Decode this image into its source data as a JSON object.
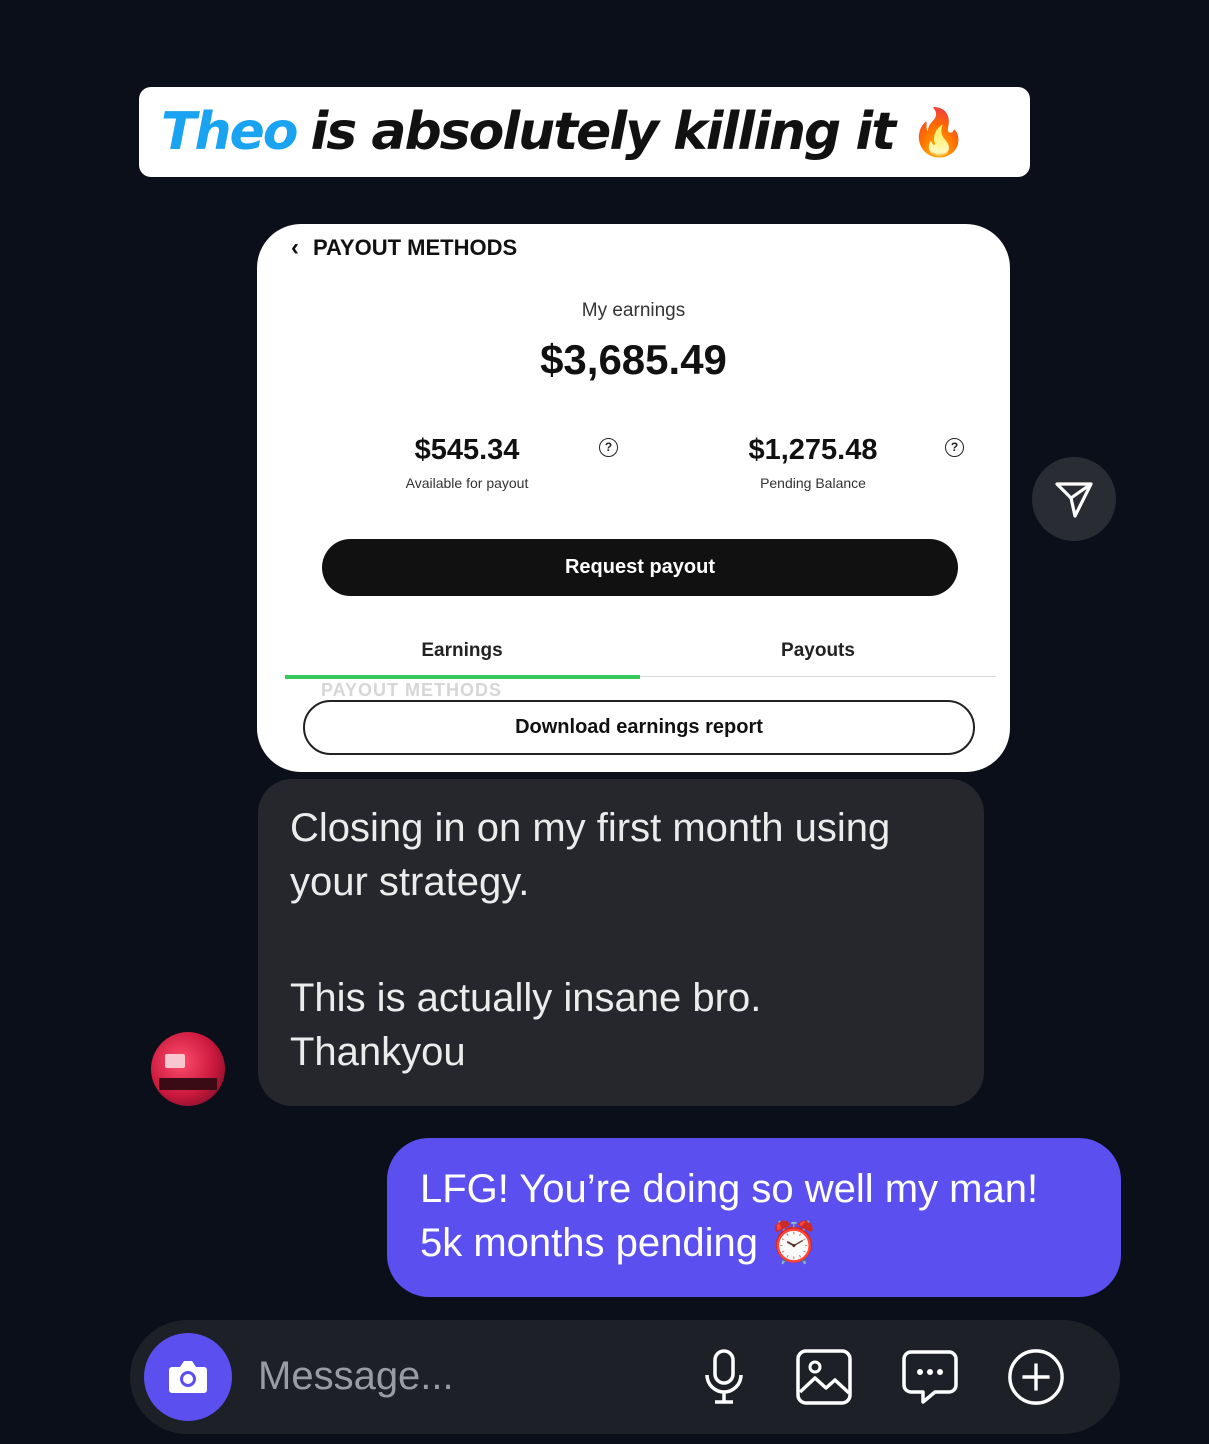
{
  "banner": {
    "name": "Theo",
    "text": "is absolutely killing it",
    "emoji": "🔥"
  },
  "payout_card": {
    "back_label": "PAYOUT METHODS",
    "earnings_label": "My earnings",
    "earnings_total": "$3,685.49",
    "available": {
      "value": "$545.34",
      "label": "Available for payout"
    },
    "pending": {
      "value": "$1,275.48",
      "label": "Pending Balance"
    },
    "help_glyph": "?",
    "request_button": "Request payout",
    "tabs": [
      "Earnings",
      "Payouts"
    ],
    "ghost_header": "PAYOUT METHODS",
    "download_button": "Download earnings report"
  },
  "incoming_message": {
    "line1": "Closing in on my first month using",
    "line2": "your strategy.",
    "line3": "This is actually insane bro.",
    "line4": "Thankyou"
  },
  "outgoing_message": {
    "line1": "LFG! You’re doing so well my man!",
    "line2": "5k months pending",
    "emoji": "⏰"
  },
  "composer": {
    "placeholder": "Message..."
  },
  "colors": {
    "background": "#0b0f1a",
    "accent": "#5b4ff0",
    "name_blue": "#1aa3f0",
    "incoming_bubble": "#25272d",
    "tab_indicator": "#34c759"
  },
  "icons": [
    "chevron-left-icon",
    "help-icon",
    "send-icon",
    "camera-icon",
    "microphone-icon",
    "image-icon",
    "sticker-chat-icon",
    "plus-circle-icon"
  ]
}
